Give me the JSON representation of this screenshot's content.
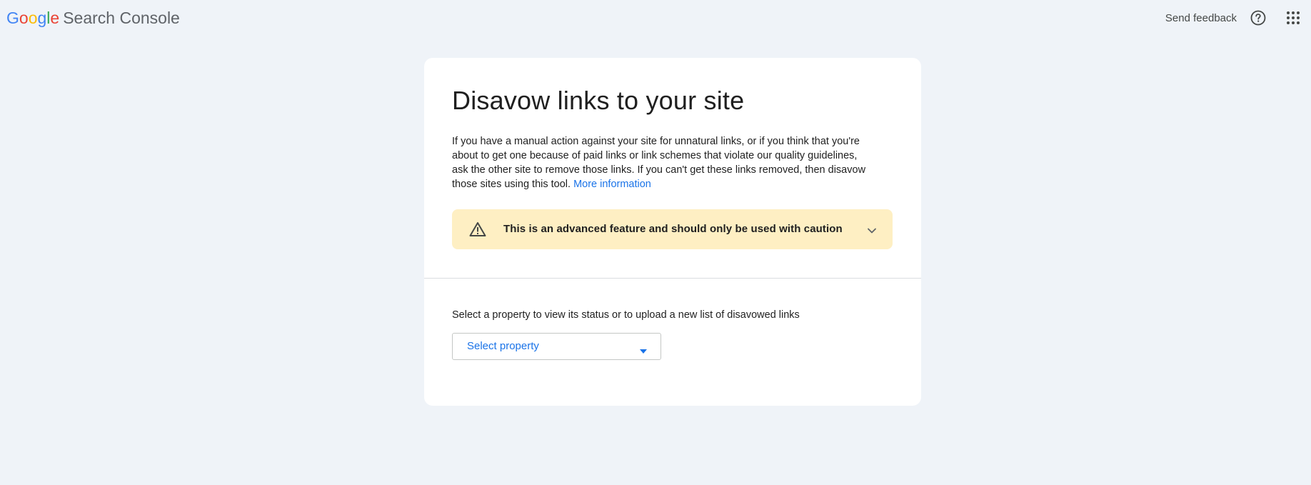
{
  "header": {
    "logo_letters": [
      "G",
      "o",
      "o",
      "g",
      "l",
      "e"
    ],
    "product_name": "Search Console",
    "send_feedback_label": "Send feedback",
    "help_icon": "help-circle-icon",
    "apps_icon": "apps-grid-icon"
  },
  "card": {
    "title": "Disavow links to your site",
    "description": "If you have a manual action against your site for unnatural links, or if you think that you're about to get one because of paid links or link schemes that violate our quality guidelines, ask the other site to remove those links. If you can't get these links removed, then disavow those sites using this tool.",
    "more_info_link": "More information",
    "warning": {
      "icon": "warning-triangle-icon",
      "text": "This is an advanced feature and should only be used with caution",
      "chevron_icon": "chevron-down-icon"
    },
    "select_label": "Select a property to view its status or to upload a new list of disavowed links",
    "select": {
      "value": "Select property",
      "caret_icon": "dropdown-caret-icon"
    }
  },
  "colors": {
    "background": "#eff3f8",
    "card": "#ffffff",
    "link": "#1a73e8",
    "warning_bg": "#feefc3",
    "google_blue": "#4285f4",
    "google_red": "#ea4335",
    "google_yellow": "#fbbc05",
    "google_green": "#34a853"
  }
}
